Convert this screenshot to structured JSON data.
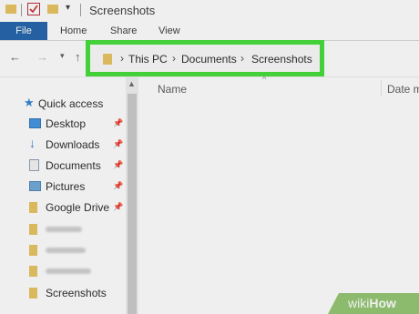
{
  "window": {
    "title": "Screenshots"
  },
  "ribbon": {
    "tabs": [
      "File",
      "Home",
      "Share",
      "View"
    ]
  },
  "address": {
    "crumbs": [
      "This PC",
      "Documents",
      "Screenshots"
    ]
  },
  "sidebar": {
    "quick_access": "Quick access",
    "items": [
      {
        "label": "Desktop",
        "icon": "desktop-icon",
        "pinned": true
      },
      {
        "label": "Downloads",
        "icon": "download-icon",
        "pinned": true
      },
      {
        "label": "Documents",
        "icon": "document-icon",
        "pinned": true
      },
      {
        "label": "Pictures",
        "icon": "pictures-icon",
        "pinned": true
      },
      {
        "label": "Google Drive",
        "icon": "folder-icon",
        "pinned": true
      },
      {
        "label": "Screenshots",
        "icon": "folder-icon",
        "pinned": false
      }
    ]
  },
  "content": {
    "col_name": "Name",
    "col_date": "Date m"
  },
  "watermark": {
    "brand_a": "wiki",
    "brand_b": "How"
  },
  "colors": {
    "accent": "#1a5ea8",
    "highlight": "#3ddc2f",
    "folder": "#e8c15a"
  }
}
